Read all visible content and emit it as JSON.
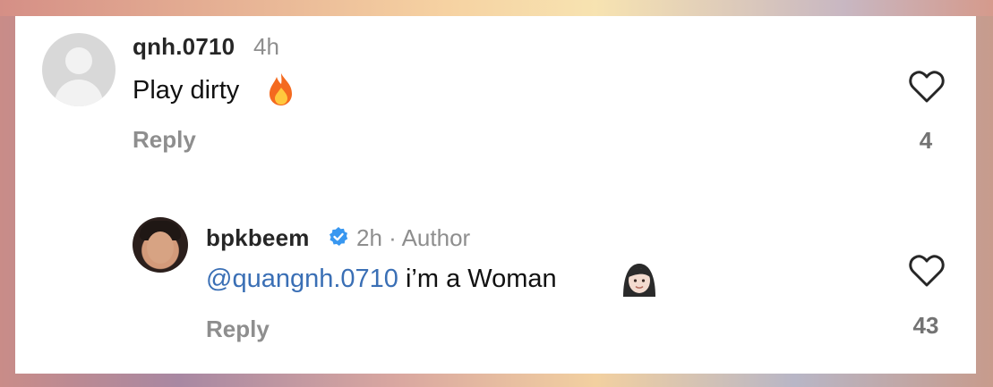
{
  "comments": [
    {
      "username": "qnh.0710",
      "time": "4h",
      "text": "Play dirty",
      "emoji": "fire-emoji",
      "reply_label": "Reply",
      "likes": "4",
      "avatar": "default-avatar-icon"
    },
    {
      "username": "bpkbeem",
      "verified": true,
      "meta": "2h · Author",
      "mention": "@quangnh.0710",
      "text": "i’m a Woman",
      "emoji": "woman-emoji",
      "reply_label": "Reply",
      "likes": "43",
      "avatar": "user-photo-avatar"
    }
  ],
  "colors": {
    "username": "#262626",
    "secondary": "#8e8e8e",
    "mention": "#3a6fb5",
    "verified": "#3897f0"
  }
}
